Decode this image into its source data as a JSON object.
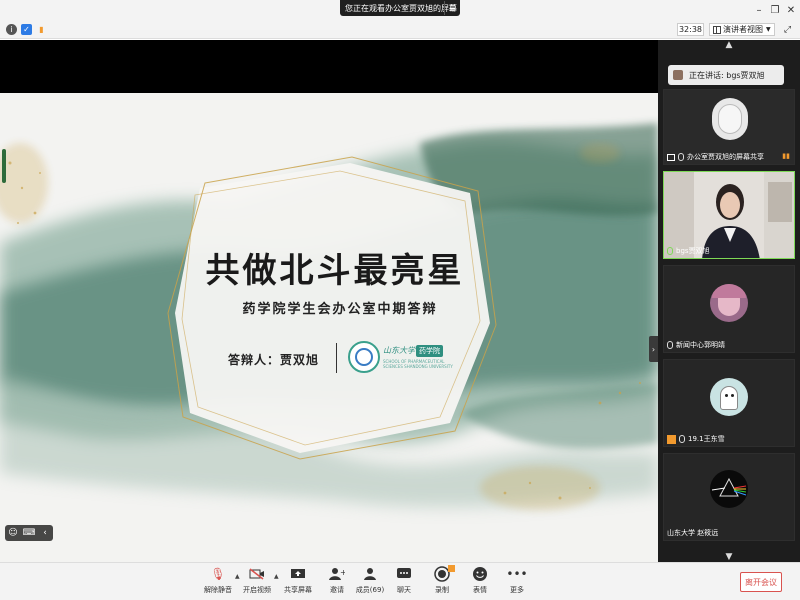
{
  "title_bar": {
    "share_notice": "您正在观看办公室贾双旭的屏幕",
    "menu_icon": "menu-icon",
    "window_controls": [
      "minimize-icon",
      "restore-icon",
      "close-icon"
    ]
  },
  "info_bar": {
    "timer": "32:38",
    "view_mode": "演讲者视图",
    "icons": [
      "info-icon",
      "shield-icon",
      "signal-icon"
    ]
  },
  "slide": {
    "title": "共做北斗最亮星",
    "subtitle": "药学院学生会办公室中期答辩",
    "presenter_label": "答辩人：贾双旭",
    "school_name": "山东大学",
    "school_tag": "药学院",
    "school_english": "SCHOOL OF PHARMACEUTICAL SCIENCES SHANDONG UNIVERSITY"
  },
  "sidebar": {
    "speaking_label": "正在讲话: bgs贾双旭",
    "participants": [
      {
        "name": "办公室贾双旭的屏幕共享",
        "type": "screen-share",
        "active": false
      },
      {
        "name": "bgs贾双旭",
        "type": "video",
        "active": true
      },
      {
        "name": "新闻中心郭明靖",
        "type": "avatar",
        "active": false
      },
      {
        "name": "19.1王东雪",
        "type": "avatar",
        "active": false
      },
      {
        "name": "山东大学 赵筱远",
        "type": "avatar",
        "active": false
      }
    ]
  },
  "toolbar": {
    "buttons": [
      {
        "label": "解除静音",
        "icon": "mic-muted-icon"
      },
      {
        "label": "开启视频",
        "icon": "camera-off-icon"
      },
      {
        "label": "共享屏幕",
        "icon": "share-screen-icon"
      },
      {
        "label": "邀请",
        "icon": "invite-icon"
      },
      {
        "label": "成员(69)",
        "icon": "members-icon"
      },
      {
        "label": "聊天",
        "icon": "chat-icon"
      },
      {
        "label": "录制",
        "icon": "record-icon"
      },
      {
        "label": "表情",
        "icon": "emoji-icon"
      },
      {
        "label": "更多",
        "icon": "more-icon"
      }
    ],
    "leave_label": "离开会议"
  },
  "colors": {
    "leave_red": "#d9534f",
    "active_border": "#7ed957",
    "ink_green": "#2f5e4a",
    "gold": "#c9a24a"
  }
}
